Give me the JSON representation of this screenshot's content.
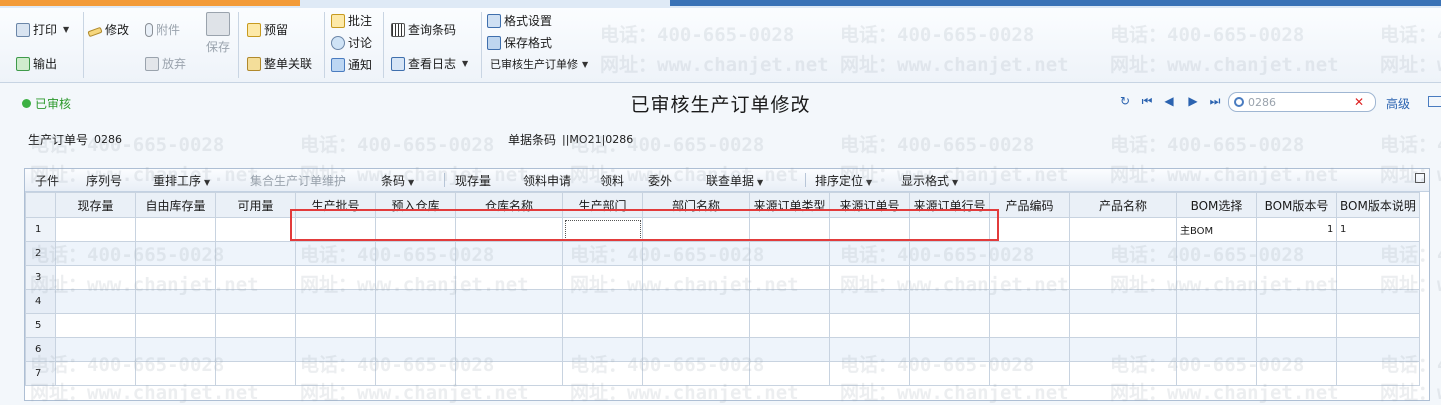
{
  "toolbar": {
    "print": "打印",
    "export": "输出",
    "modify": "修改",
    "attach": "附件",
    "discard": "放弃",
    "save": "保存",
    "reserve": "预留",
    "link_all": "整单关联",
    "annotate": "批注",
    "discuss": "讨论",
    "notify": "通知",
    "query_barcode": "查询条码",
    "view_log": "查看日志",
    "format_settings": "格式设置",
    "save_format": "保存格式",
    "current_format": "已审核生产订单修...",
    "current_format_display": "已审核生产订单修"
  },
  "status": "已审核",
  "page_title": "已审核生产订单修改",
  "search": {
    "value": "0286"
  },
  "advanced": "高级",
  "header": {
    "order_no_label": "生产订单号",
    "order_no": "0286",
    "barcode_label": "单据条码",
    "barcode": "||MO21|0286"
  },
  "grid_toolbar": [
    "子件",
    "序列号",
    "重排工序",
    "集合生产订单维护",
    "条码",
    "现存量",
    "领料申请",
    "领料",
    "委外",
    "联查单据",
    "排序定位",
    "显示格式"
  ],
  "columns": [
    "现存量",
    "自由库存量",
    "可用量",
    "生产批号",
    "预入仓库",
    "仓库名称",
    "生产部门",
    "部门名称",
    "来源订单类型",
    "来源订单号",
    "来源订单行号",
    "产品编码",
    "产品名称",
    "BOM选择",
    "BOM版本号",
    "BOM版本说明"
  ],
  "rows": [
    {
      "n": "1",
      "bom_select": "主BOM",
      "bom_version": "1",
      "bom_desc": "1"
    },
    {
      "n": "2"
    },
    {
      "n": "3"
    },
    {
      "n": "4"
    },
    {
      "n": "5"
    },
    {
      "n": "6"
    },
    {
      "n": "7"
    }
  ],
  "watermark": {
    "phone": "电话：400-665-0028",
    "site": "网址：www.chanjet.net"
  }
}
